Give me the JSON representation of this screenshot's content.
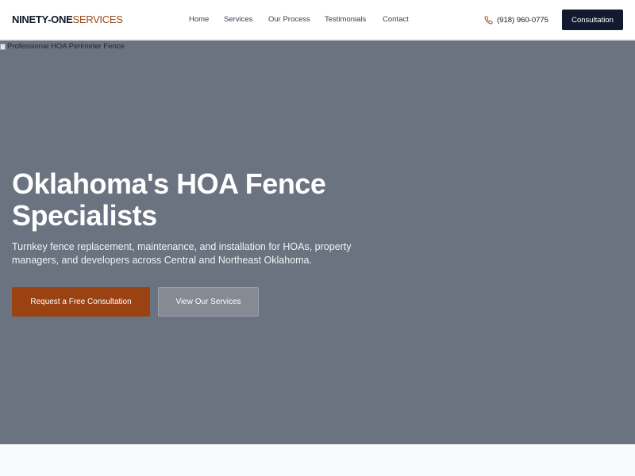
{
  "brand": {
    "part1": "NINETY-ONE",
    "part2": "SERVICES",
    "accent_color": "#9a4a14"
  },
  "nav": {
    "links": [
      "Home",
      "Services",
      "Our Process",
      "Testimonials",
      "Contact"
    ],
    "phone": "(918) 960-0775",
    "phone_icon": "phone-icon",
    "cta": "Consultation"
  },
  "hero": {
    "image_alt": "Professional HOA Perimeter Fence",
    "title": "Oklahoma's HOA Fence Specialists",
    "subtitle": "Turnkey fence replacement, maintenance, and installation for HOAs, property managers, and developers across Central and Northeast Oklahoma.",
    "primary_button": "Request a Free Consultation",
    "secondary_button": "View Our Services",
    "background_color": "#6b7280",
    "primary_color": "#9a4212"
  }
}
